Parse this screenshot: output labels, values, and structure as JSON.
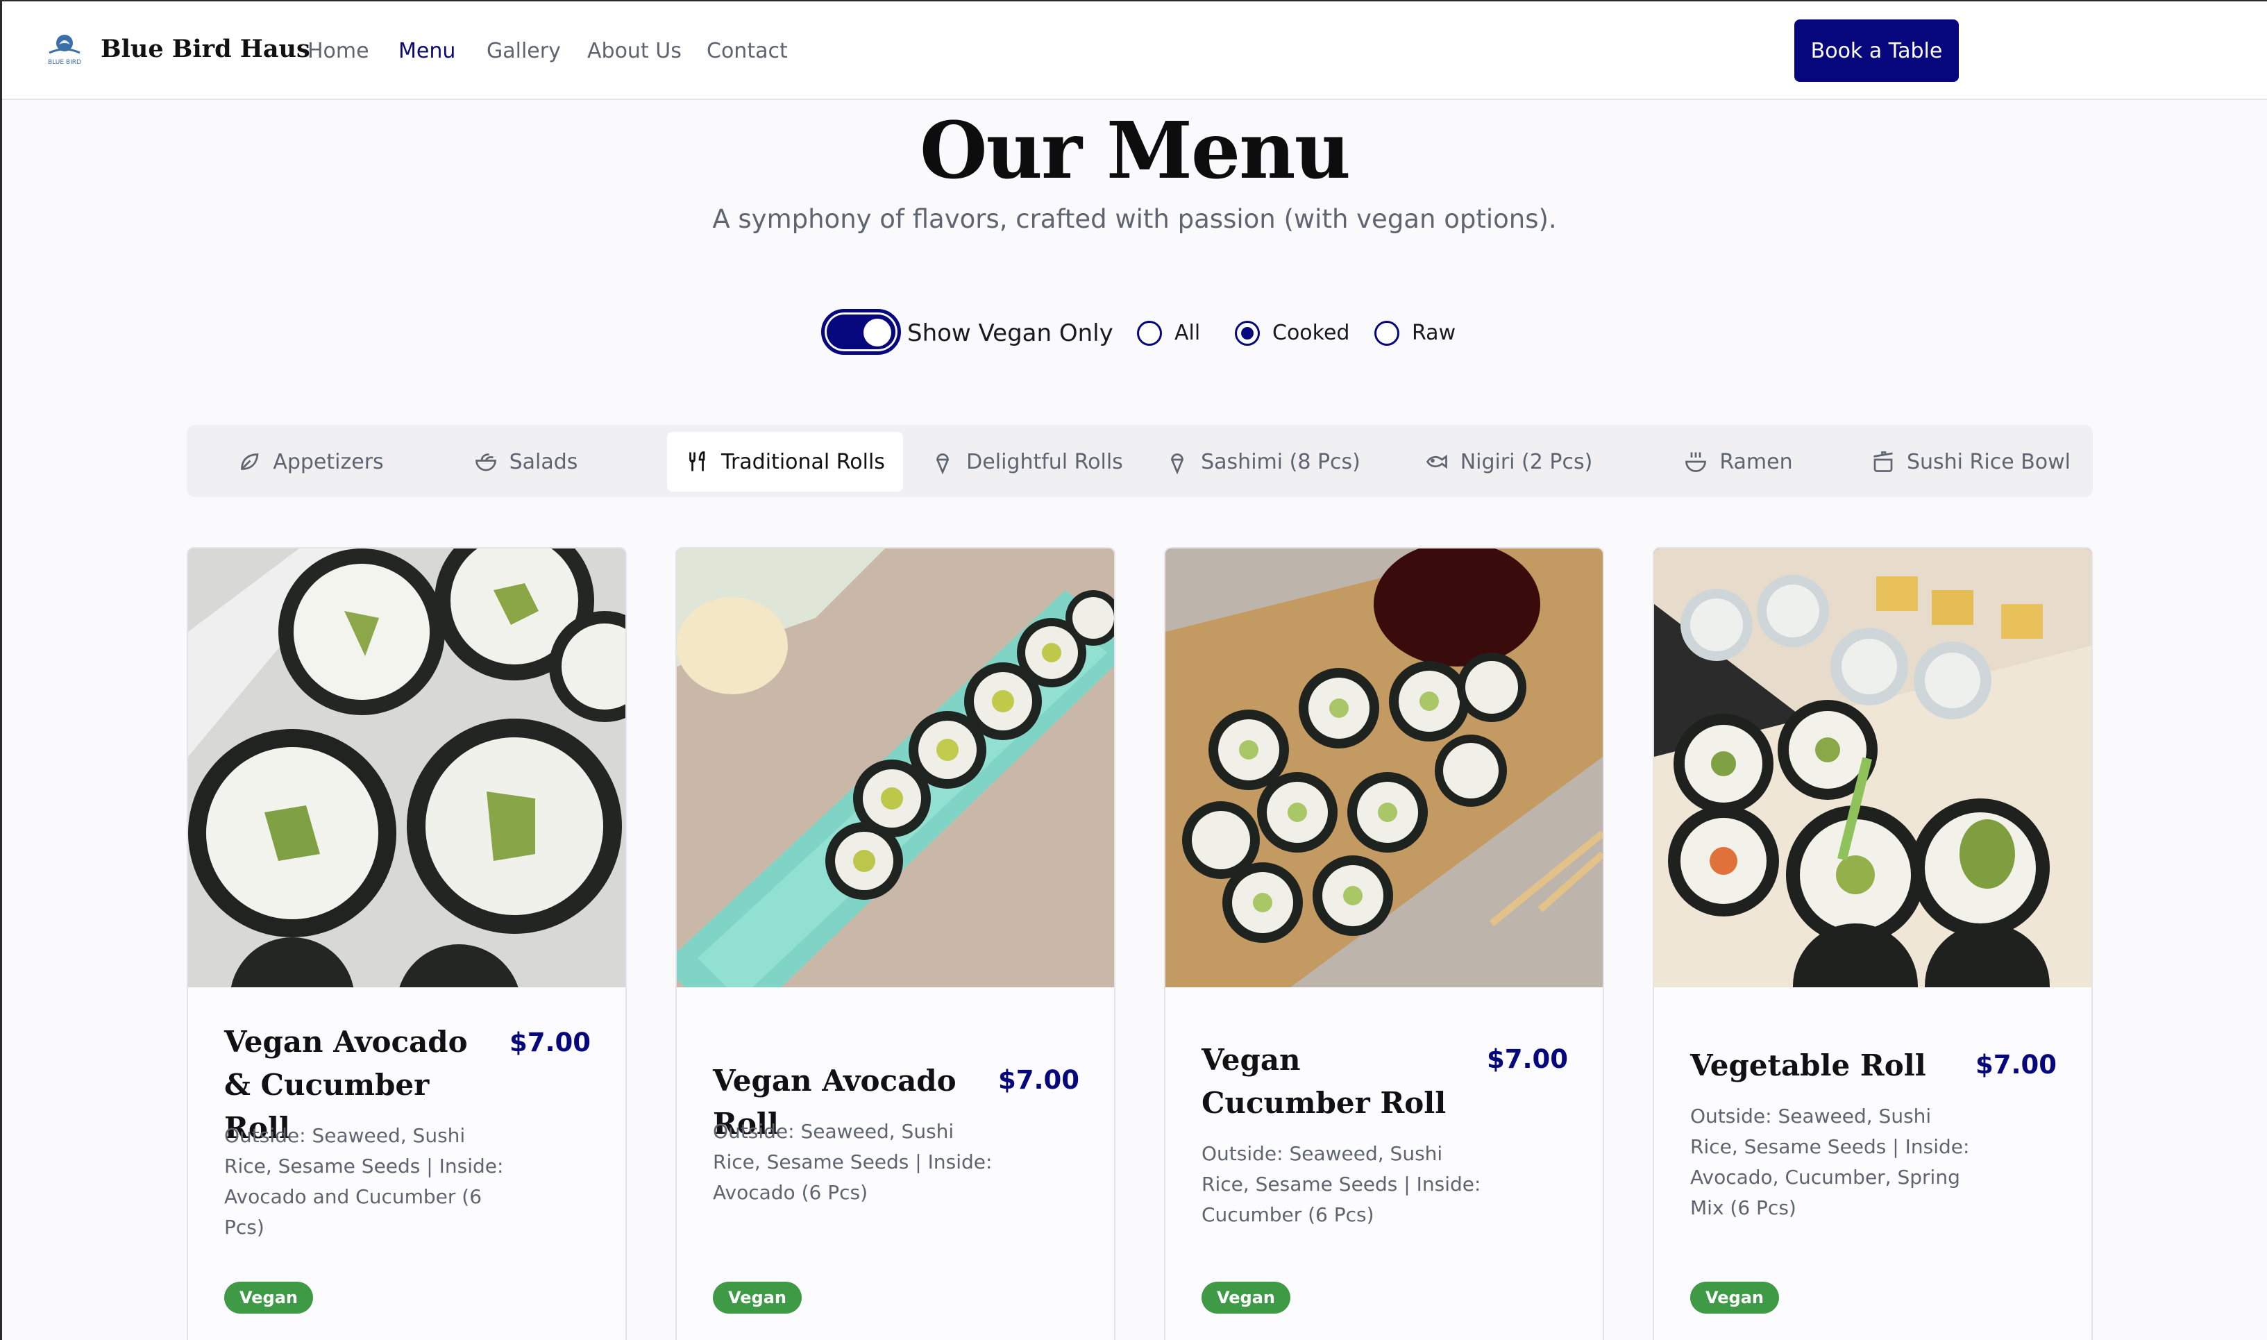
{
  "nav": {
    "brand": "Blue Bird Haus",
    "logo_text": "BLUE BIRD",
    "links": [
      "Home",
      "Menu",
      "Gallery",
      "About Us",
      "Contact"
    ],
    "active": "Menu",
    "cta": "Book a Table"
  },
  "header": {
    "title": "Our Menu",
    "subtitle": "A symphony of flavors, crafted with passion (with vegan options)."
  },
  "filters": {
    "vegan_toggle_label": "Show Vegan Only",
    "vegan_toggle_on": true,
    "radio_options": [
      "All",
      "Cooked",
      "Raw"
    ],
    "radio_selected": "Cooked"
  },
  "tabs": [
    {
      "label": "Appetizers",
      "icon": "leaf-icon"
    },
    {
      "label": "Salads",
      "icon": "salad-bowl-icon"
    },
    {
      "label": "Traditional Rolls",
      "icon": "utensils-icon",
      "active": true
    },
    {
      "label": "Delightful Rolls",
      "icon": "ice-cream-cone-icon"
    },
    {
      "label": "Sashimi (8 Pcs)",
      "icon": "ice-cream-cone-icon"
    },
    {
      "label": "Nigiri (2 Pcs)",
      "icon": "fish-icon"
    },
    {
      "label": "Ramen",
      "icon": "soup-bowl-icon"
    },
    {
      "label": "Sushi Rice Bowl",
      "icon": "cooking-pot-icon"
    }
  ],
  "cards": [
    {
      "title": "Vegan Avocado & Cucumber Roll",
      "price": "$7.00",
      "description": "Outside: Seaweed, Sushi Rice, Sesame Seeds | Inside: Avocado and Cucumber (6 Pcs)",
      "badge": "Vegan"
    },
    {
      "title": "Vegan Avocado Roll",
      "price": "$7.00",
      "description": "Outside: Seaweed, Sushi Rice, Sesame Seeds | Inside: Avocado (6 Pcs)",
      "badge": "Vegan"
    },
    {
      "title": "Vegan Cucumber Roll",
      "price": "$7.00",
      "description": "Outside: Seaweed, Sushi Rice, Sesame Seeds | Inside: Cucumber (6 Pcs)",
      "badge": "Vegan"
    },
    {
      "title": "Vegetable Roll",
      "price": "$7.00",
      "description": "Outside: Seaweed, Sushi Rice, Sesame Seeds | Inside: Avocado, Cucumber, Spring Mix (6 Pcs)",
      "badge": "Vegan"
    }
  ],
  "colors": {
    "brand": "#07077d",
    "badge_green": "#3e9a45",
    "muted_text": "#5e6470"
  }
}
